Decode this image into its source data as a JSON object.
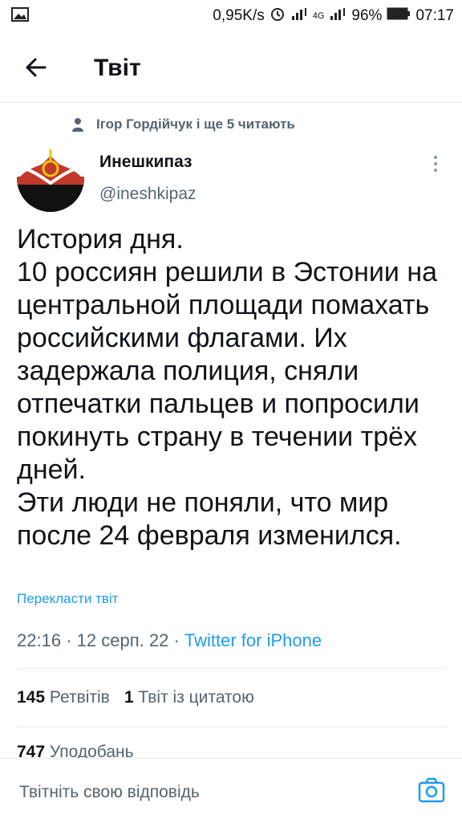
{
  "status_bar": {
    "speed": "0,95K/s",
    "network": "4G",
    "battery": "96%",
    "time": "07:17"
  },
  "header": {
    "title": "Твіт"
  },
  "context": {
    "text": "Ігор Гордійчук і ще 5 читають"
  },
  "author": {
    "name": "Инешкипаз",
    "handle": "@ineshkipaz"
  },
  "tweet": {
    "text": "История дня.\n10 россиян решили в Эстонии на центральной площади помахать российскими флагами. Их задержала полиция, сняли отпечатки пальцев и попросили покинуть страну в течении трёх дней.\nЭти люди не поняли, что мир после 24 февраля изменился.",
    "translate": "Перекласти твіт",
    "time": "22:16",
    "date": "12 серп. 22",
    "source": "Twitter for iPhone"
  },
  "stats": {
    "retweets_count": "145",
    "retweets_label": "Ретвітів",
    "quotes_count": "1",
    "quotes_label": "Твіт із цитатою",
    "likes_count": "747",
    "likes_label": "Уподобань"
  },
  "reply": {
    "placeholder": "Твітніть свою відповідь"
  },
  "icons": {
    "back": "arrow-left-icon",
    "more": "more-vertical-icon",
    "camera": "camera-icon",
    "person": "person-icon"
  },
  "colors": {
    "accent": "#1d9bf0",
    "secondary": "#536471"
  }
}
